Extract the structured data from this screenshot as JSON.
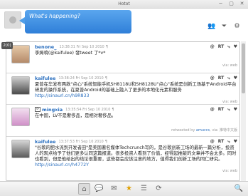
{
  "window": {
    "title": "Hotot"
  },
  "header": {
    "compose_placeholder": "What's happening?"
  },
  "badge": {
    "count": "2(0)"
  },
  "icons": {
    "minimize": "─",
    "maximize": "▢",
    "close": "✕",
    "people": "👥",
    "filter": "⏷",
    "settings": "⚙",
    "home": "⌂",
    "mentions": "💬",
    "dm": "✉",
    "favorites": "★",
    "lists": "☰",
    "retweets": "⟳",
    "search": "🔍"
  },
  "tweets": [
    {
      "user": "benone_",
      "time": "13:38:31 Fri Sep 10 2010",
      "text": "李姆噴(@kaifulee) 發tweet 了*v*",
      "link": "",
      "footer": "via: web",
      "retweeted_by": ""
    },
    {
      "user": "kaifulee",
      "time": "13:38:24 Fri Sep 10 2010",
      "text": "夏普在华发布两款\"点心\"系统智能手机SH8118U和SH8128U\"点心\"系统是创新工场基于Android平台研发的操作系统，在夏普Android的基础上融入了更多的本地化元素和服务 ",
      "link": "http://sinaurl.cn/h9R833",
      "footer": "via: web",
      "retweeted_by": ""
    },
    {
      "user": "mingxia",
      "time": "13:35:54 Fri Sep 10 2010",
      "text": "在中国，LV不是奢侈品，是相对奢侈品。",
      "link": "",
      "footer": "retweeted by",
      "retweeted_by": "amuccs",
      "footer_via": "via: 推特中文版"
    },
    {
      "user": "kaifulee",
      "time": "13:37:53 Fri Sep 10 2010",
      "text": "\"谷歌的肥水流进开发",
      "link": "",
      "footer": "",
      "retweeted_by": ""
    }
  ],
  "tweet2_extra": {
    "time": "13:37:53 Fri Sep 10 2010",
    "text": "\"谷歌的肥水流到开发者田\"是美国著名媒体Techcrunch写的，是谷歌创新工场的最新一篇分析，投资人的观点给予了他们更多认同这篇报道。很多投资人看到了价值，经得起推敲的文章并不会太多。同时也看到，但是他给出的结论很重要，这些都会应该注意的地方，值得我们创新工场的同仁研究。",
    "link": "http://sinaurl.cn/h4772Y",
    "footer": "via: web"
  },
  "tweet_actions": {
    "at": "@",
    "rt": "RT",
    "more": "⤷",
    "fav": "♥"
  },
  "colors": {
    "accent": "#2f7fd8",
    "link": "#2a6fbf"
  }
}
